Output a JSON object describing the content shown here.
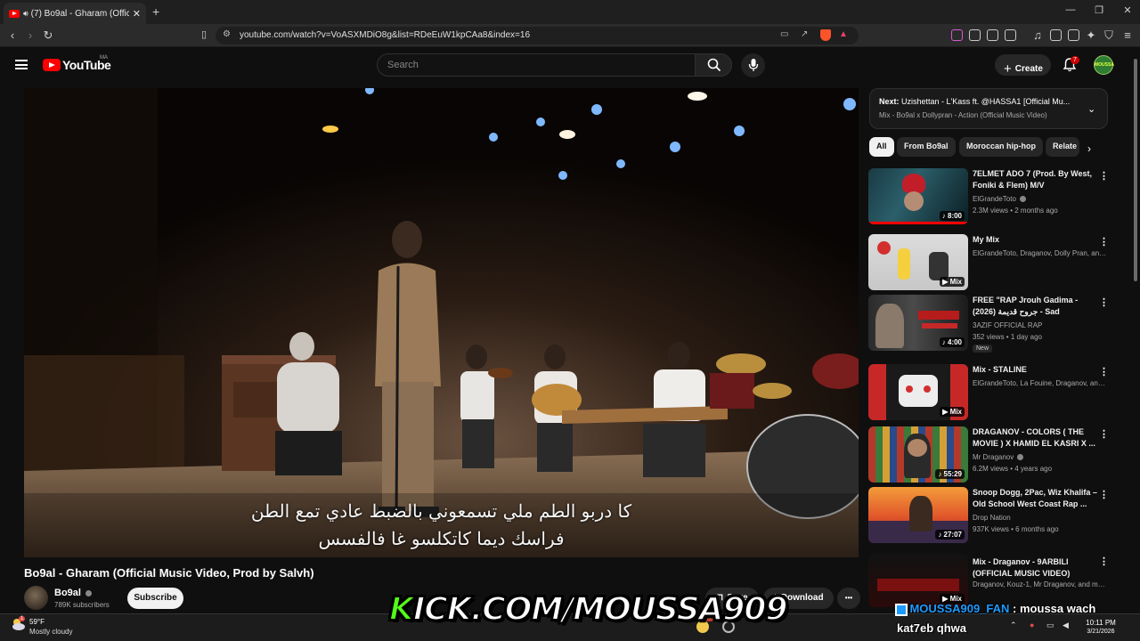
{
  "browser": {
    "tab_title": "(7) Bo9al - Gharam (Official M",
    "tab_close": "✕",
    "new_tab": "+",
    "url": "youtube.com/watch?v=VoASXMDiO8g&list=RDeEuW1kpCAa8&index=16",
    "minimize": "—",
    "restore": "❐",
    "close": "✕"
  },
  "header": {
    "logo_text": "YouTube",
    "country_code": "MA",
    "search_placeholder": "Search",
    "create_label": "Create",
    "notification_count": "7",
    "avatar_text": "MOUSSA"
  },
  "video": {
    "subtitle_line1": "كا دربو الطم ملي تسمعوني بالضبط عادي تمع الطن",
    "subtitle_line2": "فراسك ديما كاتكلسو غا فالفسس",
    "title": "Bo9al - Gharam (Official Music Video, Prod by Salvh)",
    "channel": "Bo9al",
    "subscribers": "789K subscribers",
    "subscribe_label": "Subscribe",
    "save_label": "Save",
    "download_label": "Download",
    "more_label": "•••"
  },
  "up_next": {
    "prefix": "Next:",
    "next_title": "Uzishettan - L'Kass ft. @HASSA1 [Official Mu...",
    "mix_title": "Mix - Bo9al x Dollypran - Action (Official Music Video)"
  },
  "chips": [
    "All",
    "From Bo9al",
    "Moroccan hip-hop",
    "Relate"
  ],
  "recommendations": [
    {
      "title": "7ELMET ADO 7 (Prod. By West, Foniki & Flem) M/V",
      "channel": "ElGrandeToto",
      "verified": true,
      "meta": "2.3M views • 2 months ago",
      "badge": "♪ 8:00",
      "is_new": false
    },
    {
      "title": "My Mix",
      "channel": "ElGrandeToto, Draganov, Dolly Pran, and ...",
      "verified": false,
      "meta": "",
      "badge": "▶ Mix",
      "is_new": false
    },
    {
      "title": "FREE \"RAP Jrouh Gadima - (2026) جروح قديمة - Sad Emotion...",
      "channel": "3AZIF OFFICIAL RAP",
      "verified": false,
      "meta": "352 views • 1 day ago",
      "badge": "♪ 4:00",
      "is_new": true,
      "new_label": "New"
    },
    {
      "title": "Mix - STALINE",
      "channel": "ElGrandeToto, La Fouine, Draganov, and ...",
      "verified": false,
      "meta": "",
      "badge": "▶ Mix",
      "is_new": false
    },
    {
      "title": "DRAGANOV - COLORS ( THE MOVIE ) X HAMID EL KASRI X ...",
      "channel": "Mr Draganov",
      "verified": true,
      "meta": "6.2M views • 4 years ago",
      "badge": "♪ 55:29",
      "is_new": false
    },
    {
      "title": "Snoop Dogg, 2Pac, Wiz Khalifa – Old School West Coast Rap ...",
      "channel": "Drop Nation",
      "verified": false,
      "meta": "937K views • 6 months ago",
      "badge": "♪ 27:07",
      "is_new": false
    },
    {
      "title": "Mix - Draganov - 9ARBILI (OFFICIAL MUSIC VIDEO)",
      "channel": "Draganov, Kouz-1, Mr Draganov, and more",
      "verified": false,
      "meta": "",
      "badge": "▶ Mix",
      "is_new": false
    }
  ],
  "overlay": {
    "kick_prefix": "K",
    "kick_rest": "ICK.COM/MOUSSA909",
    "chat_user": "MOUSSA909_FAN",
    "chat_sep": " : ",
    "chat_text": "moussa wach",
    "chat_text2": "kat7eb qhwa"
  },
  "taskbar": {
    "weather_badge": "1",
    "temperature": "59°F",
    "condition": "Mostly cloudy",
    "time": "10:11 PM",
    "date": "3/21/2026",
    "notif_badge": "9+"
  },
  "colors": {
    "background": "#0f0f0f",
    "youtube_red": "#ff0000",
    "kick_green": "#53fc18",
    "chat_blue": "#1e9bff"
  }
}
